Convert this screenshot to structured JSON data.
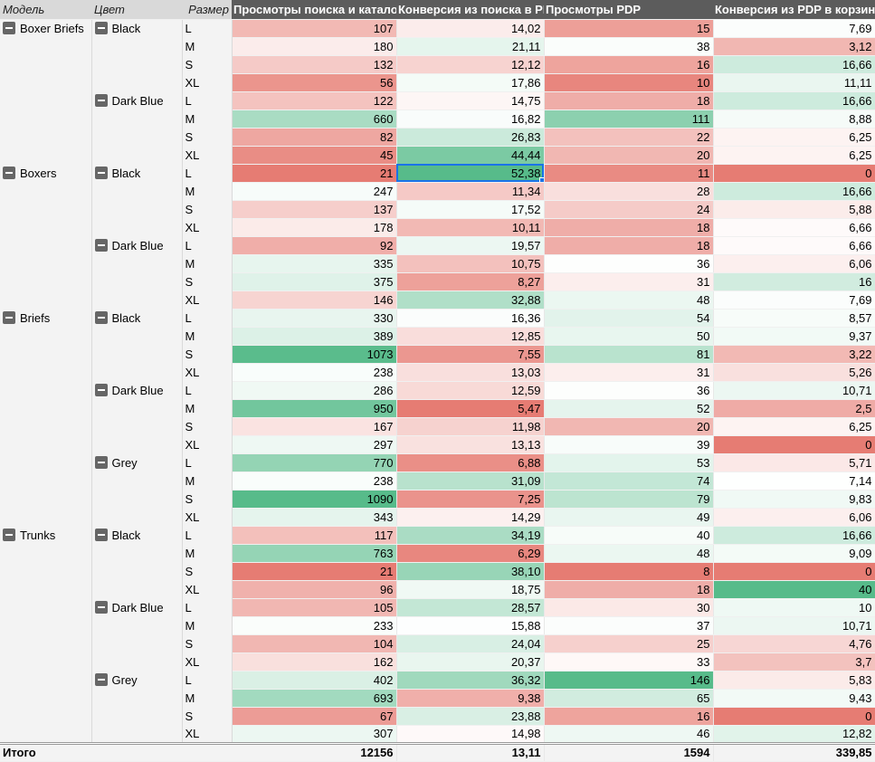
{
  "headers": {
    "model": "Модель",
    "color": "Цвет",
    "size": "Размер",
    "m1": "Просмотры поиска и каталога",
    "m2": "Конверсия из поиска в PDP",
    "m3": "Просмотры PDP",
    "m4": "Конверсия из PDP в корзину"
  },
  "scale_colors": {
    "min": "#e67c73",
    "mid": "#ffffff",
    "max": "#57bb8a"
  },
  "rows": [
    [
      "Boxer Briefs",
      "Black",
      "L",
      "107",
      "14,02",
      "15",
      "7,69"
    ],
    [
      "",
      "",
      "M",
      "180",
      "21,11",
      "38",
      "3,12"
    ],
    [
      "",
      "",
      "S",
      "132",
      "12,12",
      "16",
      "16,66"
    ],
    [
      "",
      "",
      "XL",
      "56",
      "17,86",
      "10",
      "11,11"
    ],
    [
      "",
      "Dark Blue",
      "L",
      "122",
      "14,75",
      "18",
      "16,66"
    ],
    [
      "",
      "",
      "M",
      "660",
      "16,82",
      "111",
      "8,88"
    ],
    [
      "",
      "",
      "S",
      "82",
      "26,83",
      "22",
      "6,25"
    ],
    [
      "",
      "",
      "XL",
      "45",
      "44,44",
      "20",
      "6,25"
    ],
    [
      "Boxers",
      "Black",
      "L",
      "21",
      "52,38",
      "11",
      "0"
    ],
    [
      "",
      "",
      "M",
      "247",
      "11,34",
      "28",
      "16,66"
    ],
    [
      "",
      "",
      "S",
      "137",
      "17,52",
      "24",
      "5,88"
    ],
    [
      "",
      "",
      "XL",
      "178",
      "10,11",
      "18",
      "6,66"
    ],
    [
      "",
      "Dark Blue",
      "L",
      "92",
      "19,57",
      "18",
      "6,66"
    ],
    [
      "",
      "",
      "M",
      "335",
      "10,75",
      "36",
      "6,06"
    ],
    [
      "",
      "",
      "S",
      "375",
      "8,27",
      "31",
      "16"
    ],
    [
      "",
      "",
      "XL",
      "146",
      "32,88",
      "48",
      "7,69"
    ],
    [
      "Briefs",
      "Black",
      "L",
      "330",
      "16,36",
      "54",
      "8,57"
    ],
    [
      "",
      "",
      "M",
      "389",
      "12,85",
      "50",
      "9,37"
    ],
    [
      "",
      "",
      "S",
      "1073",
      "7,55",
      "81",
      "3,22"
    ],
    [
      "",
      "",
      "XL",
      "238",
      "13,03",
      "31",
      "5,26"
    ],
    [
      "",
      "Dark Blue",
      "L",
      "286",
      "12,59",
      "36",
      "10,71"
    ],
    [
      "",
      "",
      "M",
      "950",
      "5,47",
      "52",
      "2,5"
    ],
    [
      "",
      "",
      "S",
      "167",
      "11,98",
      "20",
      "6,25"
    ],
    [
      "",
      "",
      "XL",
      "297",
      "13,13",
      "39",
      "0"
    ],
    [
      "",
      "Grey",
      "L",
      "770",
      "6,88",
      "53",
      "5,71"
    ],
    [
      "",
      "",
      "M",
      "238",
      "31,09",
      "74",
      "7,14"
    ],
    [
      "",
      "",
      "S",
      "1090",
      "7,25",
      "79",
      "9,83"
    ],
    [
      "",
      "",
      "XL",
      "343",
      "14,29",
      "49",
      "6,06"
    ],
    [
      "Trunks",
      "Black",
      "L",
      "117",
      "34,19",
      "40",
      "16,66"
    ],
    [
      "",
      "",
      "M",
      "763",
      "6,29",
      "48",
      "9,09"
    ],
    [
      "",
      "",
      "S",
      "21",
      "38,10",
      "8",
      "0"
    ],
    [
      "",
      "",
      "XL",
      "96",
      "18,75",
      "18",
      "40"
    ],
    [
      "",
      "Dark Blue",
      "L",
      "105",
      "28,57",
      "30",
      "10"
    ],
    [
      "",
      "",
      "M",
      "233",
      "15,88",
      "37",
      "10,71"
    ],
    [
      "",
      "",
      "S",
      "104",
      "24,04",
      "25",
      "4,76"
    ],
    [
      "",
      "",
      "XL",
      "162",
      "20,37",
      "33",
      "3,7"
    ],
    [
      "",
      "Grey",
      "L",
      "402",
      "36,32",
      "146",
      "5,83"
    ],
    [
      "",
      "",
      "M",
      "693",
      "9,38",
      "65",
      "9,43"
    ],
    [
      "",
      "",
      "S",
      "67",
      "23,88",
      "16",
      "0"
    ],
    [
      "",
      "",
      "XL",
      "307",
      "14,98",
      "46",
      "12,82"
    ]
  ],
  "total": {
    "label": "Итого",
    "m1": "12156",
    "m2": "13,11",
    "m3": "1594",
    "m4": "339,85"
  }
}
